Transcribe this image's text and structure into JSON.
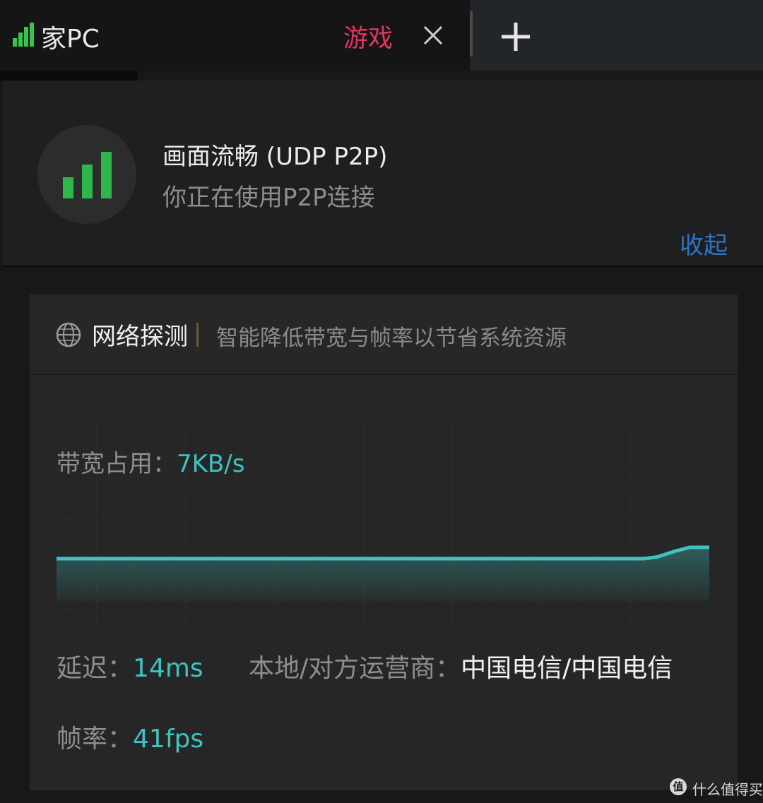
{
  "tab": {
    "title": "家PC",
    "tag": "游戏",
    "close_icon": "close-icon",
    "add_icon": "plus-icon"
  },
  "status": {
    "icon": "signal-strength-icon",
    "title": "画面流畅 (UDP P2P)",
    "subtitle": "你正在使用P2P连接",
    "collapse_label": "收起"
  },
  "card": {
    "icon": "globe-icon",
    "title": "网络探测",
    "subtitle": "智能降低带宽与帧率以节省系统资源",
    "bandwidth_label": "带宽占用：",
    "bandwidth_value": "7KB/s",
    "latency_label": "延迟：",
    "latency_value": "14ms",
    "isp_label": "本地/对方运营商：",
    "isp_value": "中国电信/中国电信",
    "fps_label": "帧率：",
    "fps_value": "41fps"
  },
  "chart_data": {
    "type": "area",
    "x": [
      0,
      0.1,
      0.2,
      0.3,
      0.4,
      0.5,
      0.6,
      0.7,
      0.8,
      0.9,
      0.92,
      0.95,
      0.97,
      1.0
    ],
    "values": [
      5,
      5,
      5,
      5,
      5,
      5,
      5,
      5,
      5,
      5,
      5.3,
      6.4,
      7,
      7
    ],
    "ylim": [
      0,
      20
    ],
    "grid": true,
    "color": "#3fc2c1"
  },
  "watermark": {
    "logo": "值",
    "text": "什么值得买"
  }
}
